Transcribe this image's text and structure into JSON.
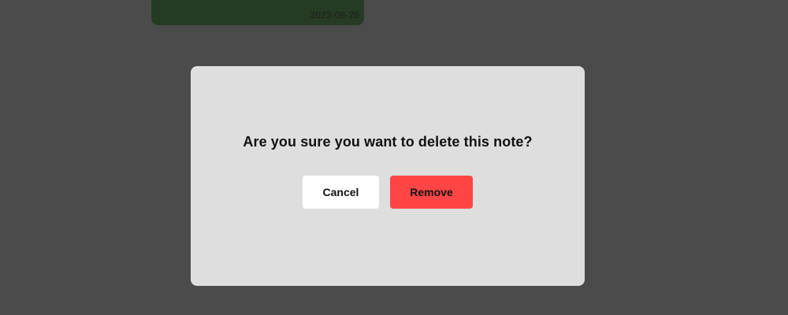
{
  "background_note": {
    "date": "2023-08-26"
  },
  "dialog": {
    "message": "Are you sure you want to delete this note?",
    "cancel_label": "Cancel",
    "remove_label": "Remove"
  },
  "colors": {
    "overlay": "#4b4b4b",
    "note_card": "#253b23",
    "dialog_bg": "#dedede",
    "cancel_bg": "#ffffff",
    "remove_bg": "#ff4546"
  }
}
